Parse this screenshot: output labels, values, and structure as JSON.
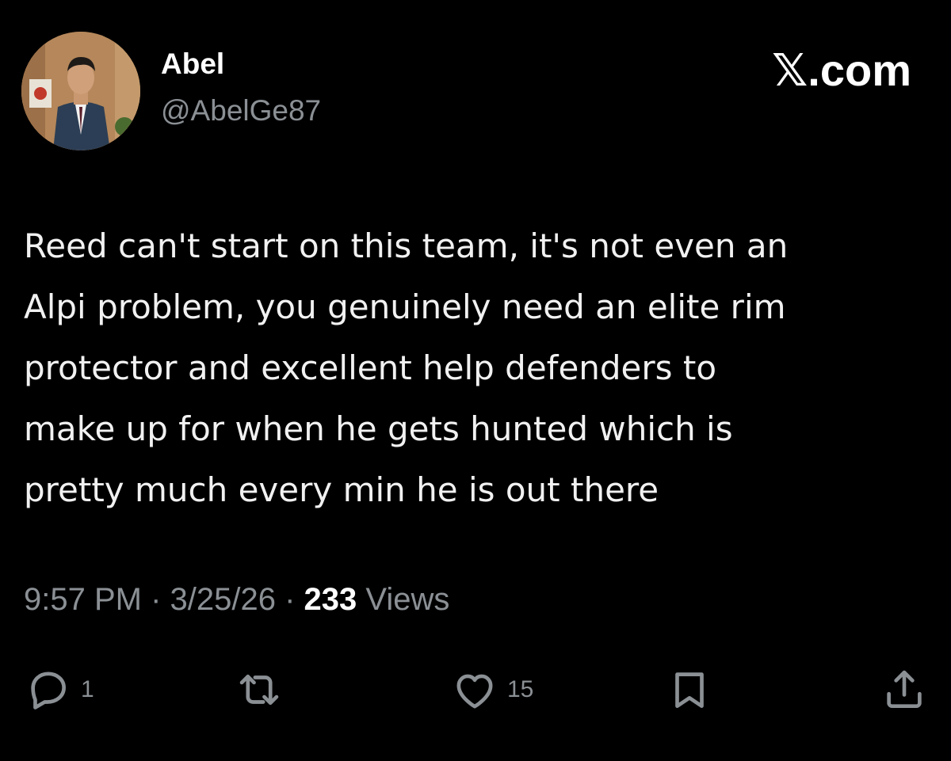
{
  "author": {
    "display_name": "Abel",
    "handle": "@AbelGe87",
    "avatar": "profile-photo"
  },
  "brand": {
    "label": "𝕏.com"
  },
  "tweet": {
    "text": "Reed can't start on this team, it's not even an\nAlpi problem, you genuinely need an elite rim\nprotector and excellent help defenders to\nmake up for when he gets hunted which is\npretty much every min he is out there",
    "time": "9:57 PM",
    "date": "3/25/26",
    "separator": " · ",
    "views_count": "233",
    "views_label": " Views"
  },
  "actions": {
    "reply": {
      "icon": "reply-icon",
      "count": "1"
    },
    "retweet": {
      "icon": "retweet-icon",
      "count": ""
    },
    "like": {
      "icon": "heart-icon",
      "count": "15"
    },
    "bookmark": {
      "icon": "bookmark-icon",
      "count": ""
    },
    "share": {
      "icon": "share-icon",
      "count": ""
    }
  },
  "colors": {
    "background": "#000000",
    "primary_text": "#e7e9ea",
    "secondary_text": "#8b9095"
  }
}
